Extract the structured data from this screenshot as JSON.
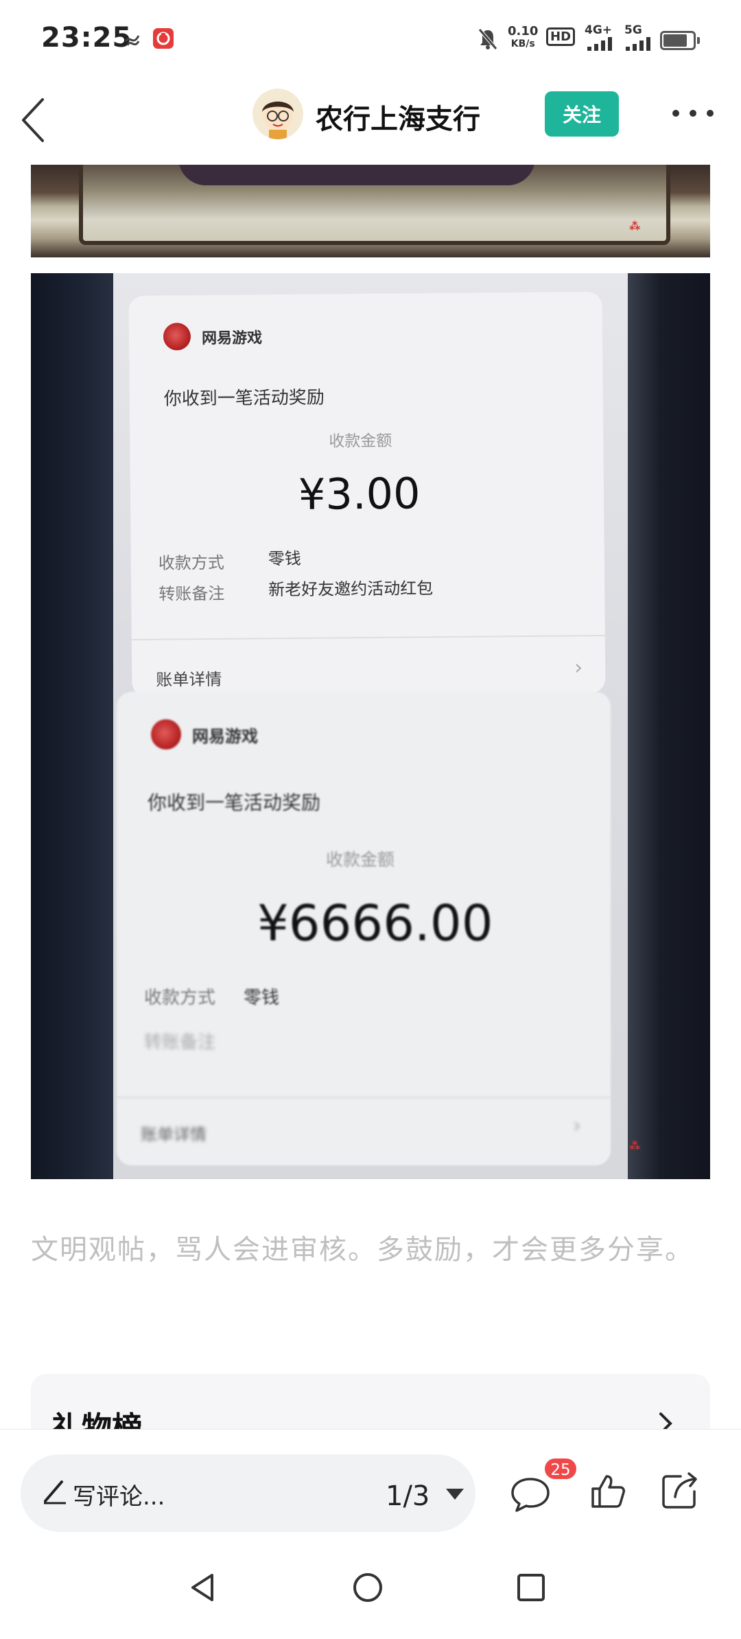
{
  "status_bar": {
    "time": "23:25",
    "net_speed_value": "0.10",
    "net_speed_unit": "KB/s",
    "hd": "HD",
    "sim_network": "4G+",
    "sim2_network": "5G"
  },
  "header": {
    "title": "农行上海支行",
    "follow_label": "关注"
  },
  "post_image": {
    "card1": {
      "app_name": "网易游戏",
      "message": "你收到一笔活动奖励",
      "amount_label": "收款金额",
      "amount": "¥3.00",
      "row1_key": "收款方式",
      "row1_value": "零钱",
      "row2_key": "转账备注",
      "row2_value": "新老好友邀约活动红包",
      "bill_label": "账单详情"
    },
    "card2": {
      "app_name": "网易游戏",
      "message": "你收到一笔活动奖励",
      "amount_label": "收款金额",
      "amount": "¥6666.00",
      "row1_key": "收款方式",
      "row1_value": "零钱",
      "row2_key": "转账备注",
      "bill_label": "账单详情"
    }
  },
  "notice": "文明观帖，骂人会进审核。多鼓励，才会更多分享。",
  "gift_section": {
    "title": "礼物榜"
  },
  "bottom_bar": {
    "comment_placeholder": "写评论...",
    "pager": "1/3",
    "comment_count": "25"
  },
  "colors": {
    "accent": "#1fb59a",
    "badge": "#f04848",
    "notice_text": "#bfbfbf"
  }
}
